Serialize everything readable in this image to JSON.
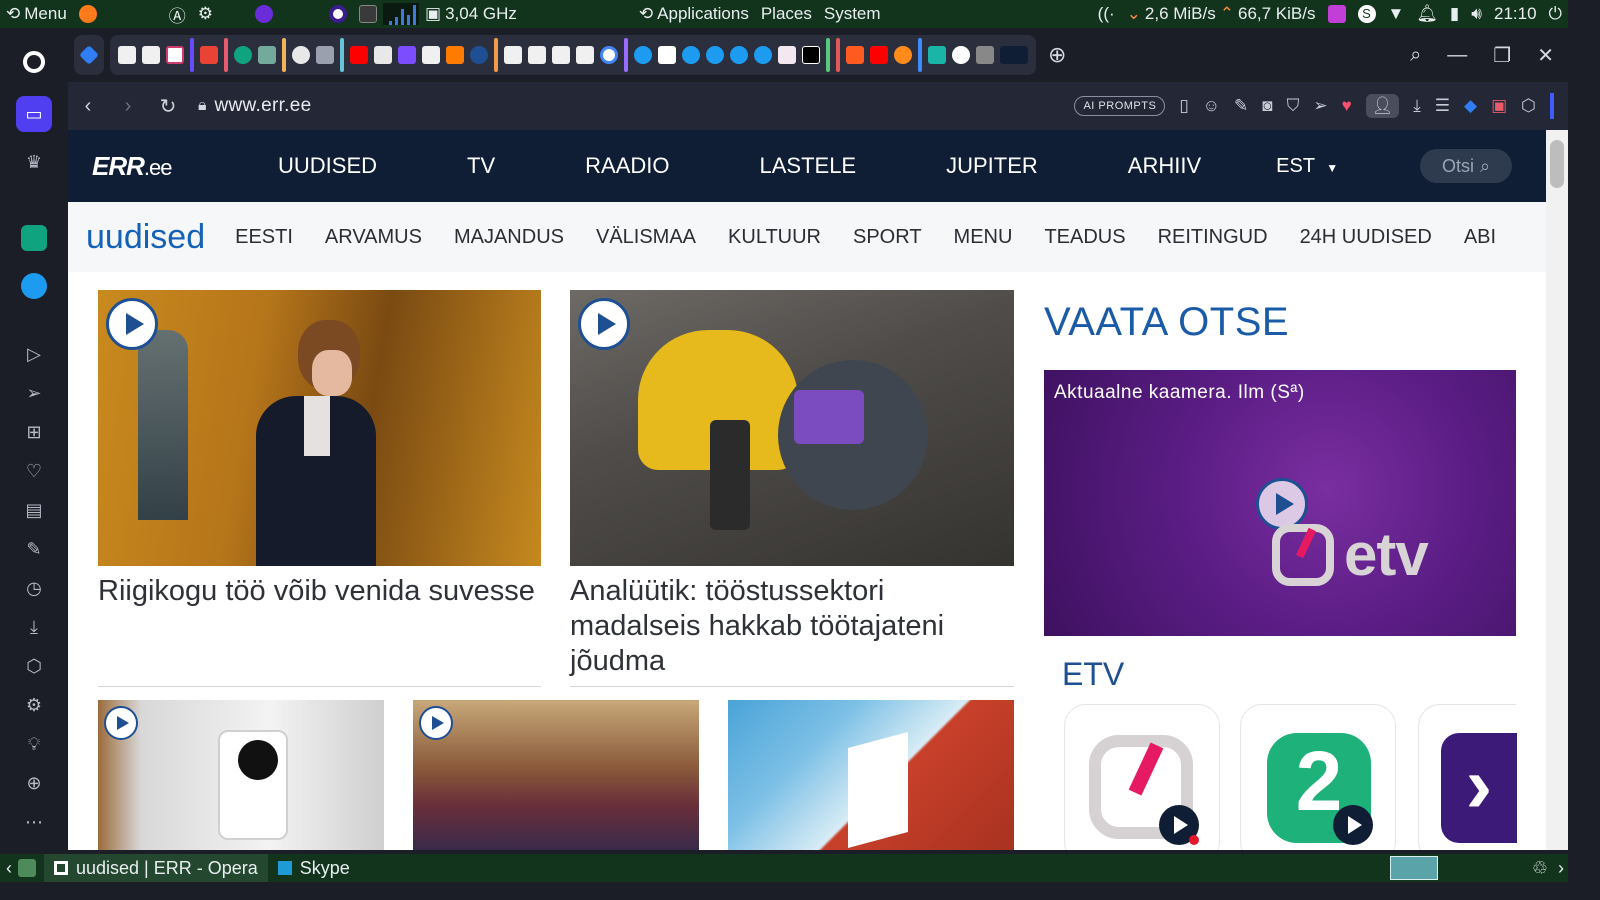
{
  "system_panel": {
    "menu_label": "Menu",
    "cpu_freq": "3,04 GHz",
    "applications_label": "Applications",
    "places_label": "Places",
    "system_label": "System",
    "net_down": "2,6 MiB/s",
    "net_up": "66,7 KiB/s",
    "clock": "21:10"
  },
  "addressbar": {
    "url": "www.err.ee",
    "ai_prompts_label": "AI PROMPTS"
  },
  "site": {
    "logo": "ERR",
    "logo_suffix": ".ee",
    "main_nav": [
      "UUDISED",
      "TV",
      "RAADIO",
      "LASTELE",
      "JUPITER",
      "ARHIIV"
    ],
    "language": "EST",
    "search_placeholder": "Otsi",
    "section_title": "uudised",
    "sub_nav": [
      "EESTI",
      "ARVAMUS",
      "MAJANDUS",
      "VÄLISMAA",
      "KULTUUR",
      "SPORT",
      "MENU",
      "TEADUS",
      "REITINGUD",
      "24H UUDISED",
      "ABI"
    ]
  },
  "stories": [
    {
      "headline": "Riigikogu töö võib venida suvesse",
      "has_video": true
    },
    {
      "headline": "Analüütik: tööstussektori madalseis hakkab töötajateni jõudma",
      "has_video": true
    }
  ],
  "live": {
    "title": "VAATA OTSE",
    "caption": "Aktuaalne kaamera. Ilm (Sª)",
    "card_logo": "etv",
    "channel_heading": "ETV"
  },
  "taskbar": {
    "tasks": [
      "uudised | ERR - Opera",
      "Skype"
    ]
  },
  "colors": {
    "panel": "#12331c",
    "err_navy": "#0f1e35",
    "err_blue": "#1461b8",
    "etv_purple": "#5b1d85",
    "opera_accent": "#4f3ff0"
  }
}
